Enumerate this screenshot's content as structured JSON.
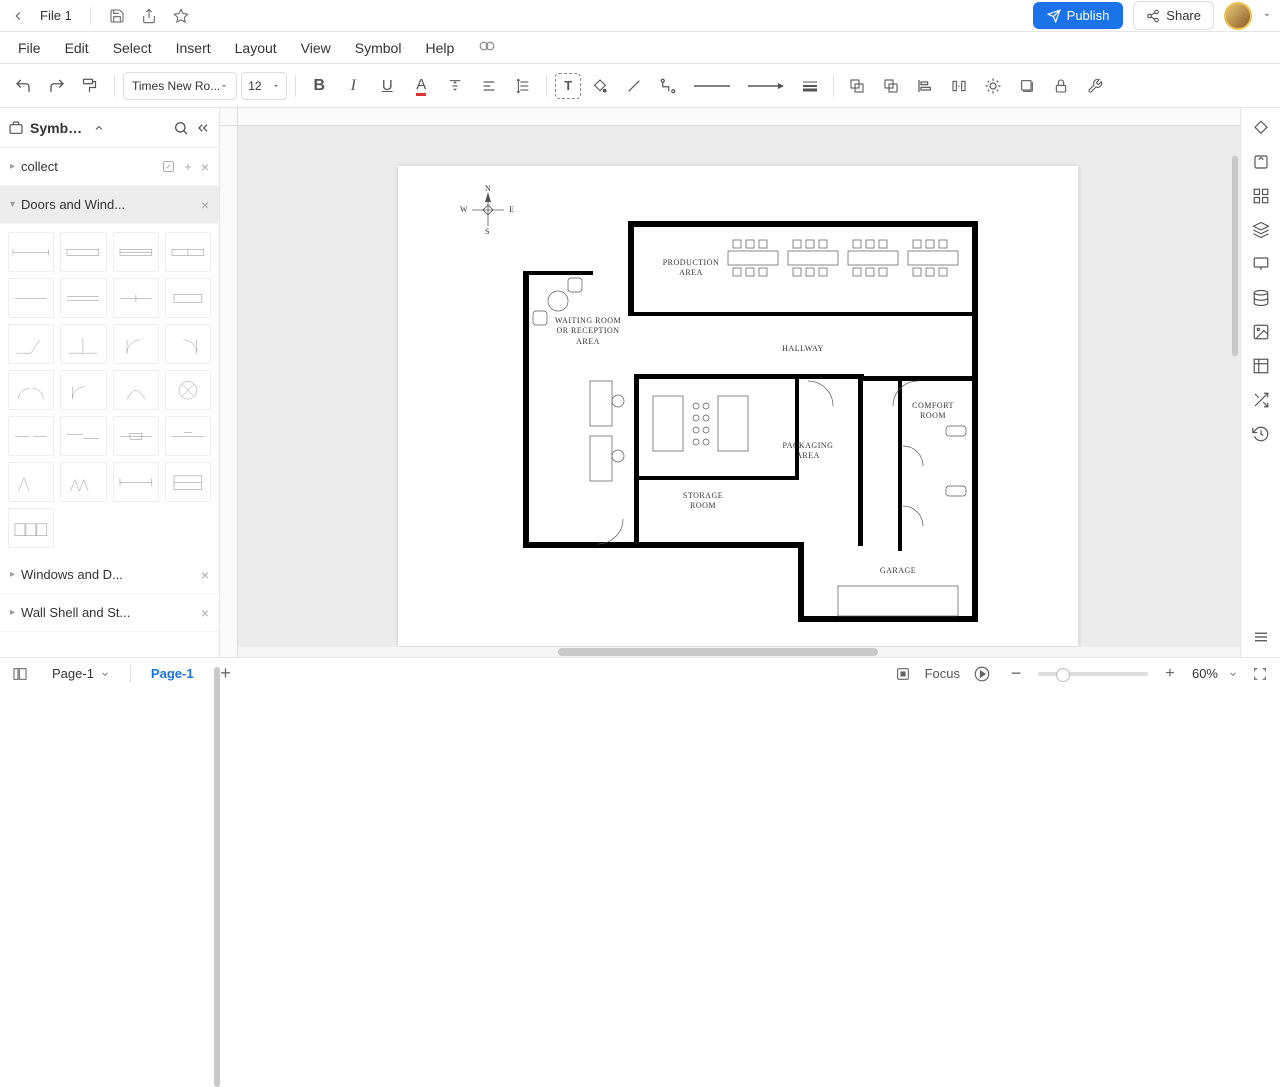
{
  "topbar": {
    "file_name": "File 1",
    "publish_label": "Publish",
    "share_label": "Share"
  },
  "menubar": {
    "items": [
      "File",
      "Edit",
      "Select",
      "Insert",
      "Layout",
      "View",
      "Symbol",
      "Help"
    ]
  },
  "toolbar": {
    "font_family": "Times New Ro...",
    "font_size": "12"
  },
  "sidebar": {
    "title": "Symbo...",
    "libraries": [
      {
        "label": "collect",
        "expanded": false,
        "active": false
      },
      {
        "label": "Doors and Wind...",
        "expanded": true,
        "active": true
      },
      {
        "label": "Windows and D...",
        "expanded": false,
        "active": false
      },
      {
        "label": "Wall Shell and St...",
        "expanded": false,
        "active": false
      }
    ]
  },
  "canvas": {
    "rooms": {
      "production": "PRODUCTION AREA",
      "waiting": "WAITING ROOM OR RECEPTION AREA",
      "hallway": "HALLWAY",
      "comfort": "COMFORT ROOM",
      "packaging": "PACKAGING AREA",
      "storage": "STORAGE ROOM",
      "garage": "GARAGE"
    },
    "compass": {
      "n": "N",
      "s": "S",
      "e": "E",
      "w": "W"
    }
  },
  "statusbar": {
    "page_selector": "Page-1",
    "page_tab": "Page-1",
    "focus_label": "Focus",
    "zoom_level": "60%"
  }
}
